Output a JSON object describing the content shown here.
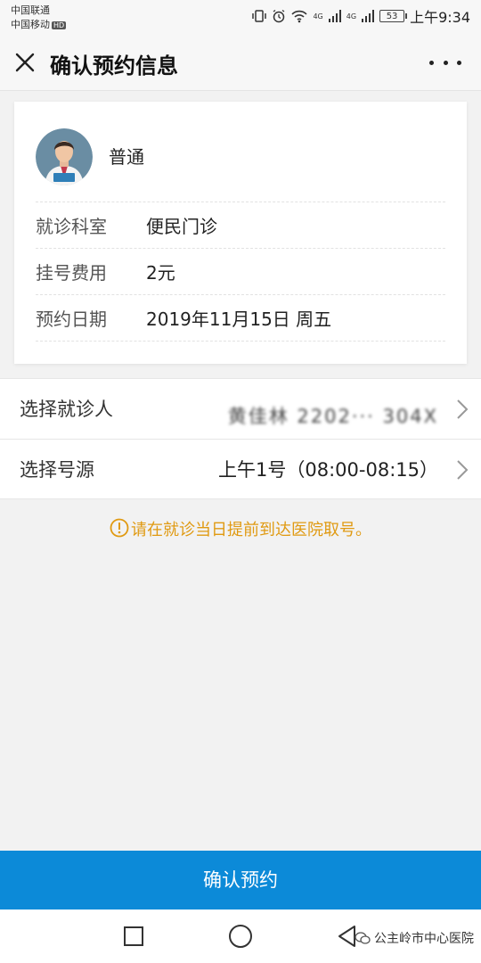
{
  "status_bar": {
    "carrier1": "中国联通",
    "carrier2": "中国移动",
    "hd": "HD",
    "net1": "4G",
    "net2": "4G",
    "battery": "53",
    "time": "上午9:34"
  },
  "header": {
    "title": "确认预约信息",
    "close_icon": "close-icon",
    "more_icon": "more-icon"
  },
  "doctor": {
    "type": "普通",
    "info": [
      {
        "label": "就诊科室",
        "value": "便民门诊"
      },
      {
        "label": "挂号费用",
        "value": "2元"
      },
      {
        "label": "预约日期",
        "value": "2019年11月15日 周五"
      }
    ]
  },
  "selection": {
    "patient_label": "选择就诊人",
    "patient_value_masked": "黄佳林 2202··· 304X",
    "source_label": "选择号源",
    "source_value": "上午1号（08:00-08:15）"
  },
  "notice": {
    "text": "请在就诊当日提前到达医院取号。",
    "color": "#e09a12"
  },
  "confirm": {
    "label": "确认预约",
    "color": "#0c8ad8"
  },
  "watermark": {
    "text": "公主岭市中心医院"
  }
}
